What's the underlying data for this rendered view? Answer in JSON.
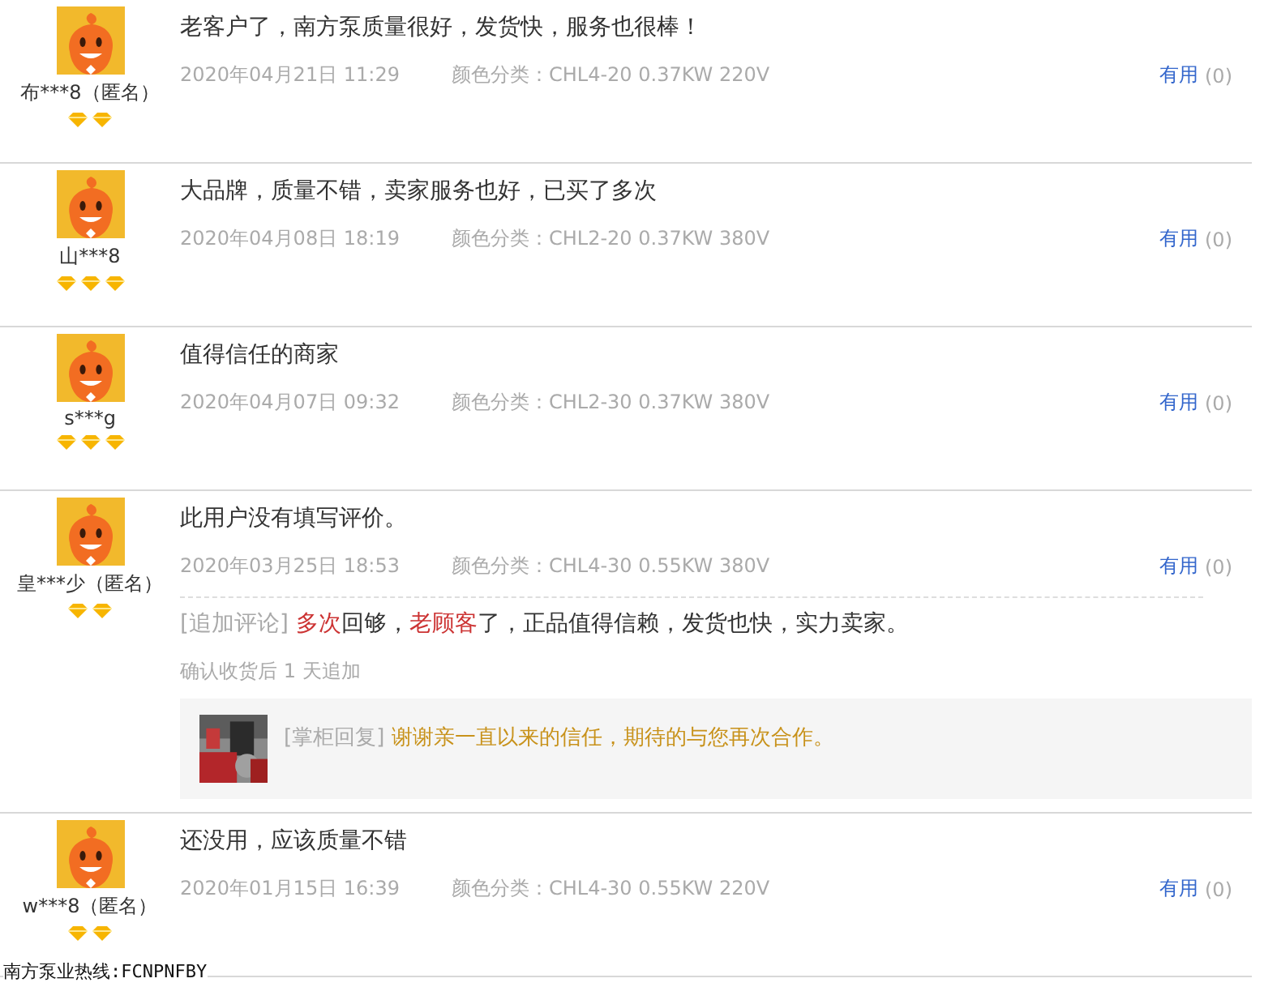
{
  "reviews": [
    {
      "user": "布***8（匿名）",
      "badges": [
        {
          "kind": "diamond"
        },
        {
          "kind": "diamond"
        }
      ],
      "comment": [
        {
          "text": "老客户了，南方泵质量很好，发货快，服务也很棒！",
          "highlight": false
        }
      ],
      "date": "2020年04月21日 11:29",
      "variant": "颜色分类：CHL4-20 0.37KW 220V",
      "useful": "有用",
      "useful_count": "(0)"
    },
    {
      "user": "山***8",
      "badges": [
        {
          "kind": "diamond"
        },
        {
          "kind": "diamond"
        },
        {
          "kind": "diamond"
        }
      ],
      "comment": [
        {
          "text": "大品牌，质量不错，卖家服务也好，已买了多次",
          "highlight": false
        }
      ],
      "date": "2020年04月08日 18:19",
      "variant": "颜色分类：CHL2-20 0.37KW 380V",
      "useful": "有用",
      "useful_count": "(0)"
    },
    {
      "user": "s***g",
      "badges": [
        {
          "kind": "diamond"
        },
        {
          "kind": "diamond"
        },
        {
          "kind": "diamond"
        }
      ],
      "comment": [
        {
          "text": "值得信任的商家",
          "highlight": false
        }
      ],
      "date": "2020年04月07日 09:32",
      "variant": "颜色分类：CHL2-30 0.37KW 380V",
      "useful": "有用",
      "useful_count": "(0)"
    },
    {
      "user": "皇***少（匿名）",
      "badges": [
        {
          "kind": "diamond"
        },
        {
          "kind": "diamond"
        }
      ],
      "comment": [
        {
          "text": "此用户没有填写评价。",
          "highlight": false
        }
      ],
      "date": "2020年03月25日 18:53",
      "variant": "颜色分类：CHL4-30 0.55KW 380V",
      "useful": "有用",
      "useful_count": "(0)",
      "followup": {
        "tag": "[追加评论]",
        "parts": [
          {
            "text": "多次",
            "highlight": true
          },
          {
            "text": "回够，",
            "highlight": false
          },
          {
            "text": "老顾客",
            "highlight": true
          },
          {
            "text": "了，正品值得信赖，发货也快，实力卖家。",
            "highlight": false
          }
        ],
        "note": "确认收货后 1 天追加"
      },
      "reply": {
        "tag": "[掌柜回复]",
        "text": "谢谢亲一直以来的信任，期待的与您再次合作。"
      }
    },
    {
      "user": "w***8（匿名）",
      "badges": [
        {
          "kind": "diamond"
        },
        {
          "kind": "diamond"
        }
      ],
      "comment": [
        {
          "text": "还没用，应该质量不错",
          "highlight": false
        }
      ],
      "date": "2020年01月15日 16:39",
      "variant": "颜色分类：CHL4-30 0.55KW 220V",
      "useful": "有用",
      "useful_count": "(0)"
    }
  ],
  "caption": "南方泵业热线:FCNPNFBY"
}
